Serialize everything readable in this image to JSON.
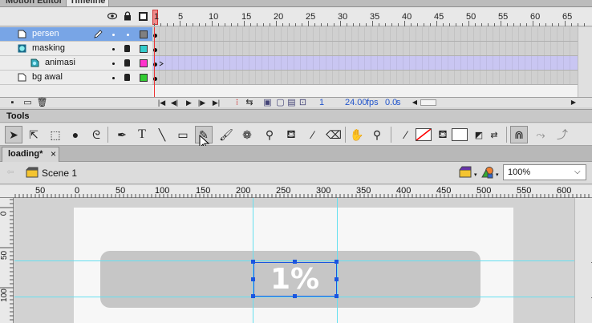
{
  "panels": {
    "motion_editor_tab": "Motion Editor",
    "timeline_tab": "Timeline"
  },
  "timeline": {
    "frame_numbers": [
      "1",
      "5",
      "10",
      "15",
      "20",
      "25",
      "30",
      "35",
      "40",
      "45",
      "50",
      "55",
      "60",
      "65"
    ],
    "layers": [
      {
        "name": "persen",
        "selected": true,
        "type": "normal",
        "color": "#808080"
      },
      {
        "name": "masking",
        "selected": false,
        "type": "mask",
        "color": "#33cccc"
      },
      {
        "name": "animasi",
        "selected": false,
        "type": "masked",
        "color": "#ff33cc"
      },
      {
        "name": "bg awal",
        "selected": false,
        "type": "normal",
        "color": "#33cc33"
      }
    ],
    "footer": {
      "current_frame": "1",
      "fps": "24.00",
      "fps_unit": "fps",
      "elapsed": "0.0",
      "elapsed_unit": "s"
    }
  },
  "tools": {
    "title": "Tools",
    "fill_color": "#ffffff",
    "stroke_color": "#ff0000"
  },
  "document": {
    "tab_label": "loading*",
    "close_glyph": "×",
    "scene_name": "Scene 1",
    "zoom": "100%"
  },
  "rulers": {
    "horizontal": [
      "50",
      "0",
      "50",
      "100",
      "150",
      "200",
      "250",
      "300",
      "350",
      "400",
      "450",
      "500",
      "550",
      "600"
    ],
    "vertical": [
      "0",
      "50",
      "100"
    ]
  },
  "stage": {
    "text": "1%",
    "stage_color": "#f7f7f7",
    "bar_color": "#c6c6c6",
    "guide_color": "#66e0f0",
    "selection_color": "#1a55e0"
  }
}
